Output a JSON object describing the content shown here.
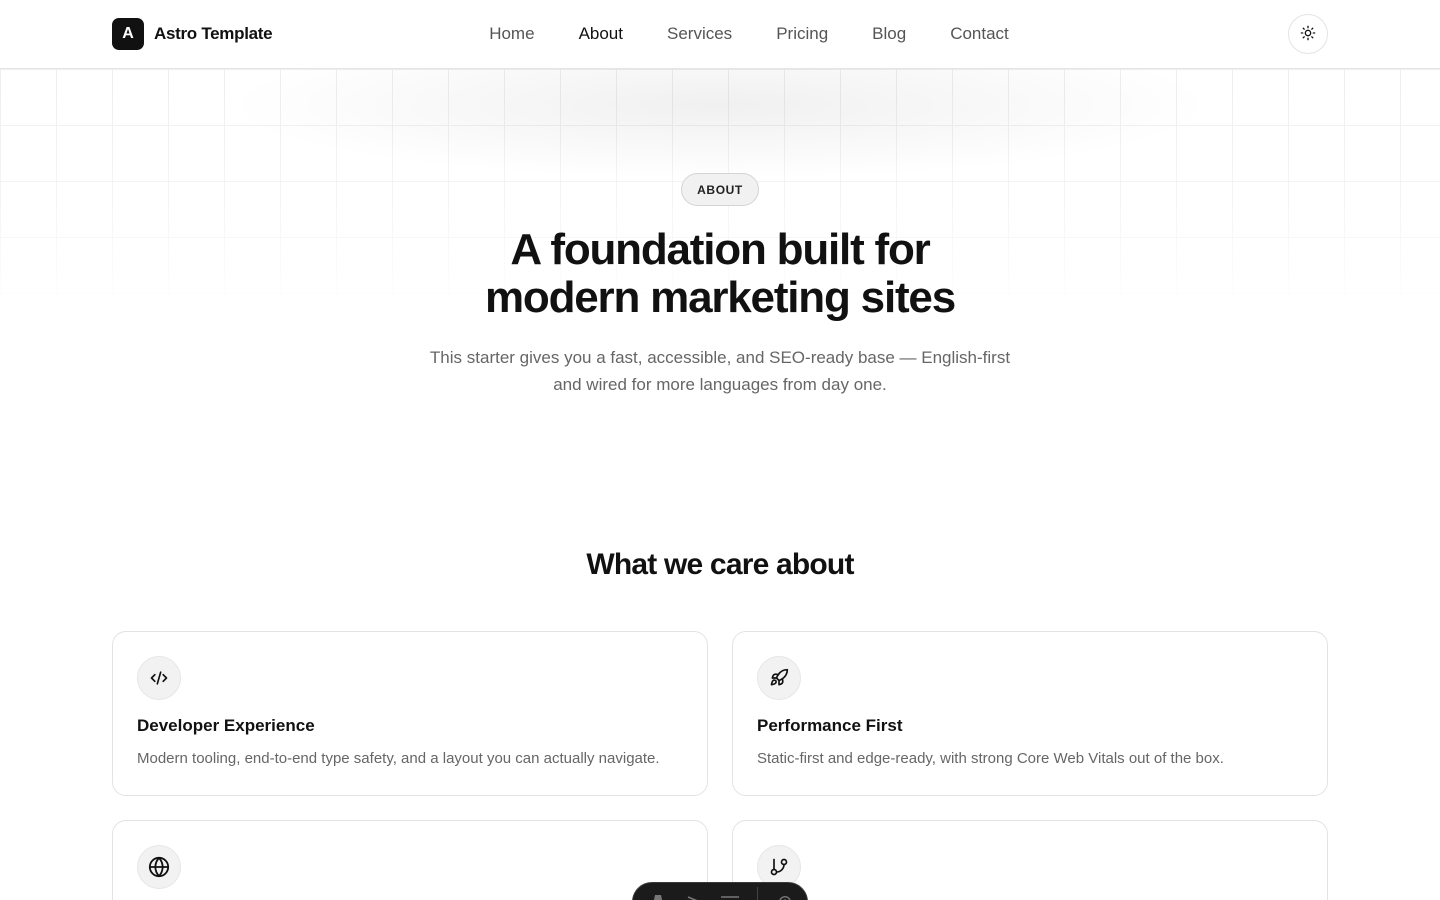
{
  "header": {
    "brand_mark": "A",
    "brand_name": "Astro Template",
    "nav": [
      {
        "label": "Home",
        "active": false
      },
      {
        "label": "About",
        "active": true
      },
      {
        "label": "Services",
        "active": false
      },
      {
        "label": "Pricing",
        "active": false
      },
      {
        "label": "Blog",
        "active": false
      },
      {
        "label": "Contact",
        "active": false
      }
    ],
    "theme_toggle_icon": "sun-icon"
  },
  "hero": {
    "badge": "ABOUT",
    "title_line1": "A foundation built for",
    "title_line2": "modern marketing sites",
    "subtitle_line1": "This starter gives you a fast, accessible, and SEO-ready base — English-first",
    "subtitle_line2": "and wired for more languages from day one."
  },
  "values": {
    "title": "What we care about",
    "cards": [
      {
        "icon": "code-icon",
        "title": "Developer Experience",
        "description": "Modern tooling, end-to-end type safety, and a layout you can actually navigate."
      },
      {
        "icon": "rocket-icon",
        "title": "Performance First",
        "description": "Static-first and edge-ready, with strong Core Web Vitals out of the box."
      },
      {
        "icon": "globe-icon",
        "title": "",
        "description": ""
      },
      {
        "icon": "git-branch-icon",
        "title": "",
        "description": ""
      }
    ]
  },
  "dev_toolbar": {
    "icons": [
      "astro-icon",
      "audit-icon",
      "menu-icon",
      "settings-icon"
    ]
  },
  "colors": {
    "text": "#111111",
    "muted": "#666666",
    "border": "#e3e3e3",
    "brand_bg": "#111111",
    "toolbar_bg": "#1b1b1b"
  }
}
